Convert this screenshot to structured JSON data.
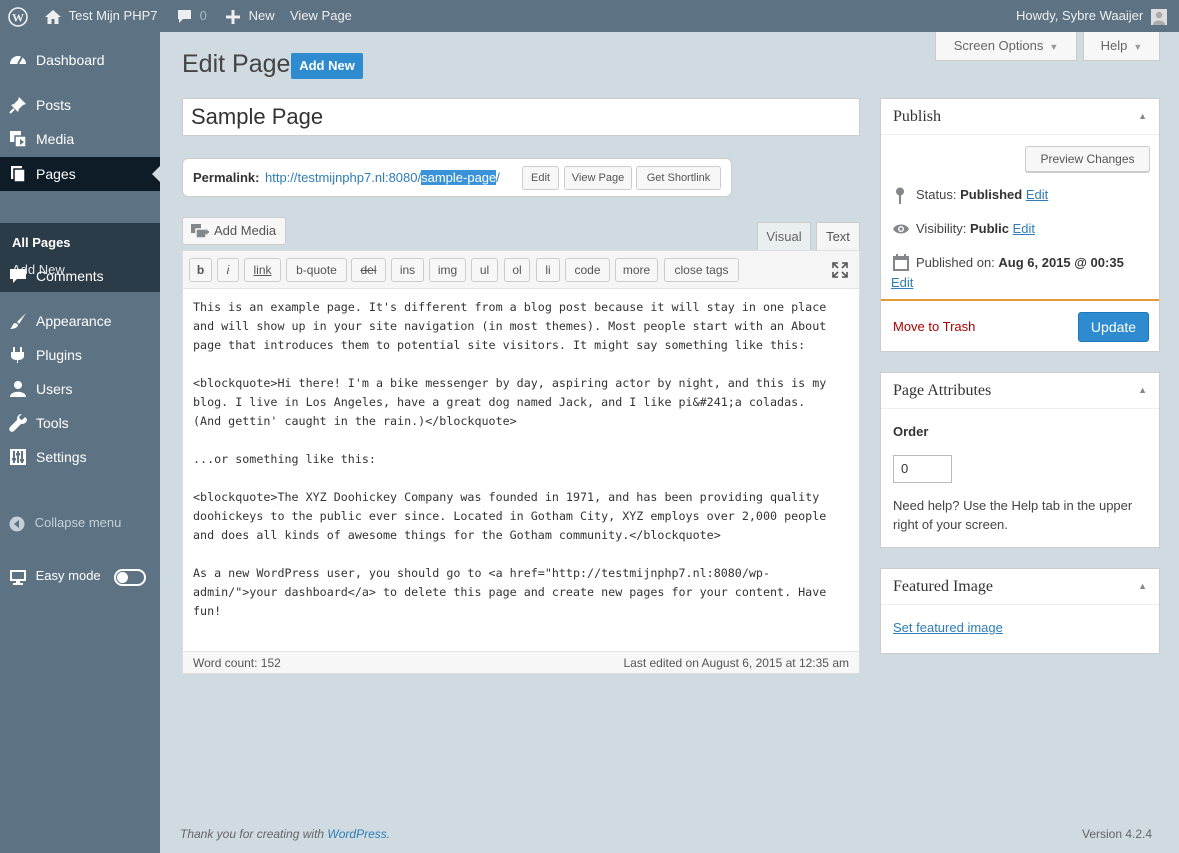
{
  "admin_bar": {
    "site_name": "Test Mijn PHP7",
    "comments_count": "0",
    "new_label": "New",
    "view_page_label": "View Page",
    "howdy": "Howdy, Sybre Waaijer"
  },
  "sidebar": {
    "items": [
      {
        "label": "Dashboard",
        "icon": "dashboard-icon"
      },
      {
        "label": "Posts",
        "icon": "pin-icon"
      },
      {
        "label": "Media",
        "icon": "media-icon"
      },
      {
        "label": "Pages",
        "icon": "pages-icon"
      },
      {
        "label": "Comments",
        "icon": "comment-icon"
      },
      {
        "label": "Appearance",
        "icon": "brush-icon"
      },
      {
        "label": "Plugins",
        "icon": "plug-icon"
      },
      {
        "label": "Users",
        "icon": "user-icon"
      },
      {
        "label": "Tools",
        "icon": "wrench-icon"
      },
      {
        "label": "Settings",
        "icon": "settings-icon"
      }
    ],
    "submenu": [
      "All Pages",
      "Add New"
    ],
    "collapse_label": "Collapse menu",
    "easy_mode_label": "Easy mode"
  },
  "header": {
    "title": "Edit Page",
    "add_new": "Add New",
    "screen_options": "Screen Options",
    "help": "Help"
  },
  "post": {
    "title": "Sample Page",
    "permalink_label": "Permalink:",
    "permalink_base": "http://testmijnphp7.nl:8080/",
    "permalink_slug": "sample-page",
    "permalink_trail": "/",
    "edit_btn": "Edit",
    "view_page_btn": "View Page",
    "shortlink_btn": "Get Shortlink"
  },
  "editor": {
    "add_media": "Add Media",
    "tab_visual": "Visual",
    "tab_text": "Text",
    "quicktags": [
      "b",
      "i",
      "link",
      "b-quote",
      "del",
      "ins",
      "img",
      "ul",
      "ol",
      "li",
      "code",
      "more",
      "close tags"
    ],
    "content": "This is an example page. It's different from a blog post because it will stay in one place\nand will show up in your site navigation (in most themes). Most people start with an About\npage that introduces them to potential site visitors. It might say something like this:\n\n<blockquote>Hi there! I'm a bike messenger by day, aspiring actor by night, and this is my\nblog. I live in Los Angeles, have a great dog named Jack, and I like pi&#241;a coladas.\n(And gettin' caught in the rain.)</blockquote>\n\n...or something like this:\n\n<blockquote>The XYZ Doohickey Company was founded in 1971, and has been providing quality\ndoohickeys to the public ever since. Located in Gotham City, XYZ employs over 2,000 people\nand does all kinds of awesome things for the Gotham community.</blockquote>\n\nAs a new WordPress user, you should go to <a href=\"http://testmijnphp7.nl:8080/wp-\nadmin/\">your dashboard</a> to delete this page and create new pages for your content. Have\nfun!",
    "word_count": "Word count: 152",
    "last_edited": "Last edited on August 6, 2015 at 12:35 am"
  },
  "publish": {
    "title": "Publish",
    "preview_changes": "Preview Changes",
    "status_label": "Status:",
    "status_value": "Published",
    "visibility_label": "Visibility:",
    "visibility_value": "Public",
    "published_label": "Published on:",
    "published_value": "Aug 6, 2015 @ 00:35",
    "edit_link": "Edit",
    "move_to_trash": "Move to Trash",
    "update": "Update"
  },
  "page_attributes": {
    "title": "Page Attributes",
    "order_label": "Order",
    "order_value": "0",
    "help_text_1": "Need help? Use the Help tab in the upper",
    "help_text_2": "right of your screen."
  },
  "featured_image": {
    "title": "Featured Image",
    "set_link": "Set featured image"
  },
  "footer": {
    "thanks_prefix": "Thank you for creating with ",
    "thanks_link": "WordPress",
    "thanks_suffix": ".",
    "version": "Version 4.2.4"
  },
  "colors": {
    "admin_bar": "#5d7384",
    "sidebar_current": "#0e1c28",
    "submenu": "#2b3b47",
    "primary_button": "#2e8bd0",
    "link": "#2e7db8",
    "trash": "#aa0000",
    "publish_accent": "#e59b33"
  }
}
